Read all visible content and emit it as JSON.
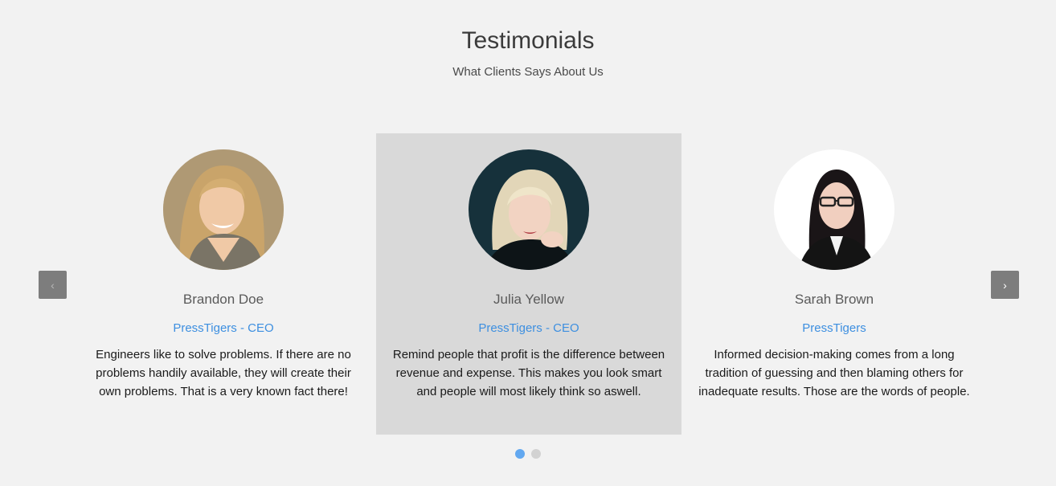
{
  "header": {
    "title": "Testimonials",
    "subtitle": "What Clients Says About Us"
  },
  "testimonials": [
    {
      "name": "Brandon Doe",
      "role": "PressTigers - CEO",
      "quote": "Engineers like to solve problems. If there are no problems handily available, they will create their own problems. That is a very known fact there!"
    },
    {
      "name": "Julia Yellow",
      "role": "PressTigers - CEO",
      "quote": "Remind people that profit is the difference between revenue and expense. This makes you look smart and people will most likely think so aswell."
    },
    {
      "name": "Sarah Brown",
      "role": "PressTigers",
      "quote": "Informed decision-making comes from a long tradition of guessing and then blaming others for inadequate results. Those are the words of people."
    }
  ],
  "carousel": {
    "prev_icon": "‹",
    "next_icon": "›",
    "active_index": 1,
    "page_count": 2,
    "active_page": 0
  },
  "colors": {
    "background": "#f2f2f2",
    "active_card": "#d9d9d9",
    "accent": "#3d8fe0",
    "dot_active": "#62a8f0",
    "nav_button": "#7d7d7d"
  },
  "icons": {
    "prev": "chevron-left-icon",
    "next": "chevron-right-icon"
  }
}
